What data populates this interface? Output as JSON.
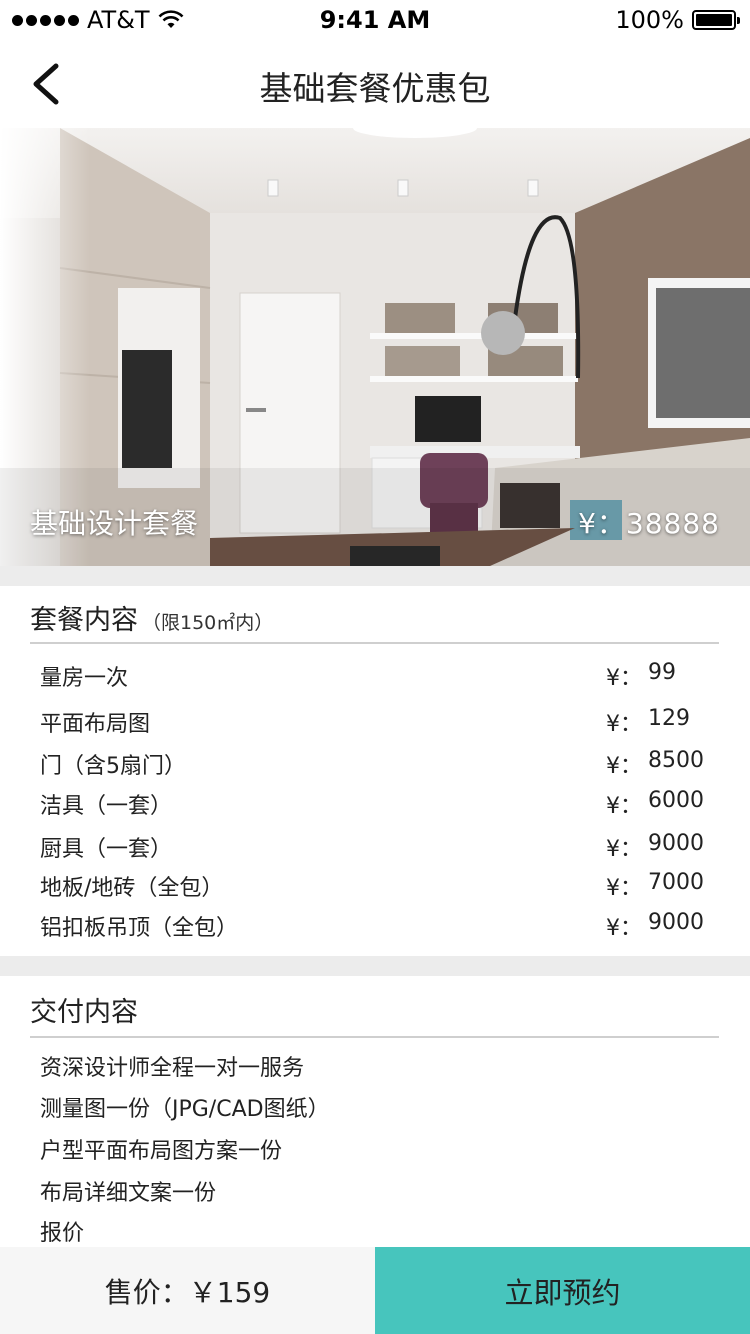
{
  "status_bar": {
    "carrier": "AT&T",
    "time": "9:41 AM",
    "battery": "100%"
  },
  "nav": {
    "title": "基础套餐优惠包"
  },
  "hero": {
    "name": "基础设计套餐",
    "price": "¥：38888"
  },
  "package": {
    "title": "套餐内容",
    "note": "（限150㎡内）",
    "items": [
      {
        "label": "量房一次",
        "currency": "¥：",
        "value": "99"
      },
      {
        "label": "平面布局图",
        "currency": "¥：",
        "value": "129"
      },
      {
        "label": "门（含5扇门）",
        "currency": "¥：",
        "value": "8500"
      },
      {
        "label": "洁具（一套）",
        "currency": "¥：",
        "value": "6000"
      },
      {
        "label": "厨具（一套）",
        "currency": "¥：",
        "value": "9000"
      },
      {
        "label": "地板/地砖（全包）",
        "currency": "¥：",
        "value": "7000"
      },
      {
        "label": "铝扣板吊顶（全包）",
        "currency": "¥：",
        "value": "9000"
      }
    ]
  },
  "delivery": {
    "title": "交付内容",
    "items": [
      "资深设计师全程一对一服务",
      "测量图一份（JPG/CAD图纸）",
      "户型平面布局图方案一份",
      "布局详细文案一份",
      "报价"
    ]
  },
  "footer": {
    "price_label": "售价：￥159",
    "book_label": "立即预约"
  },
  "colors": {
    "accent": "#47c5bd",
    "gap": "#ececec"
  }
}
